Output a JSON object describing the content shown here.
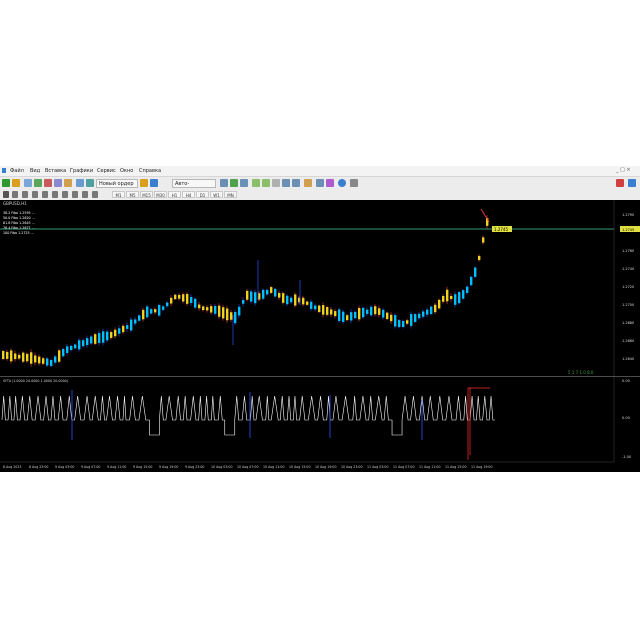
{
  "menu": [
    "Файл",
    "Вид",
    "Вставка",
    "Графики",
    "Сервис",
    "Окно",
    "Справка"
  ],
  "toolbar": {
    "new_order": "Новый ордер",
    "autotrading": "Авто-торговля"
  },
  "timeframes": [
    "M1",
    "M5",
    "M15",
    "M30",
    "H1",
    "H4",
    "D1",
    "W1",
    "MN"
  ],
  "chart": {
    "symbol_title": "GBPUSD,H1",
    "fib_rows": [
      "38.2 Fibo 1.2595 ...",
      "50.0 Fibo 1.2620 ...",
      "61.8 Fibo 1.2645 ...",
      "76.4 Fibo 1.2677 ...",
      "100 Fibo 1.2725 ..."
    ],
    "price_ticks": [
      "1.2790",
      "1.2760",
      "1.2740",
      "1.2720",
      "1.2700",
      "1.2680",
      "1.2660",
      "1.2640"
    ],
    "current_price_label": "1.2745",
    "level_label": "1.2745",
    "corner_label": "5  1  7  1.0  8.0",
    "indicator_title": "SFTA  (1.0000  20.0000  1.0000  20.0000)",
    "indicator_ticks": [
      "0.00",
      "0.00",
      "-1.00"
    ],
    "time_labels": [
      "8 Aug 2023",
      "8 Aug 23:00",
      "9 Aug 03:00",
      "9 Aug 07:00",
      "9 Aug 11:00",
      "9 Aug 15:00",
      "9 Aug 19:00",
      "9 Aug 23:00",
      "10 Aug 03:00",
      "10 Aug 07:00",
      "10 Aug 11:00",
      "10 Aug 15:00",
      "10 Aug 19:00",
      "10 Aug 23:00",
      "11 Aug 03:00",
      "11 Aug 07:00",
      "11 Aug 11:00",
      "11 Aug 15:00",
      "11 Aug 19:00"
    ]
  },
  "colors": {
    "up_candle": "#00bfff",
    "down_candle": "#f0d020",
    "wick_up": "#3050ff",
    "wick_down": "#ff4040",
    "level_line": "#40d0a0",
    "label_bg": "#e0e040",
    "indicator_line": "#ffffff",
    "indicator_signal": "#ff3030"
  }
}
